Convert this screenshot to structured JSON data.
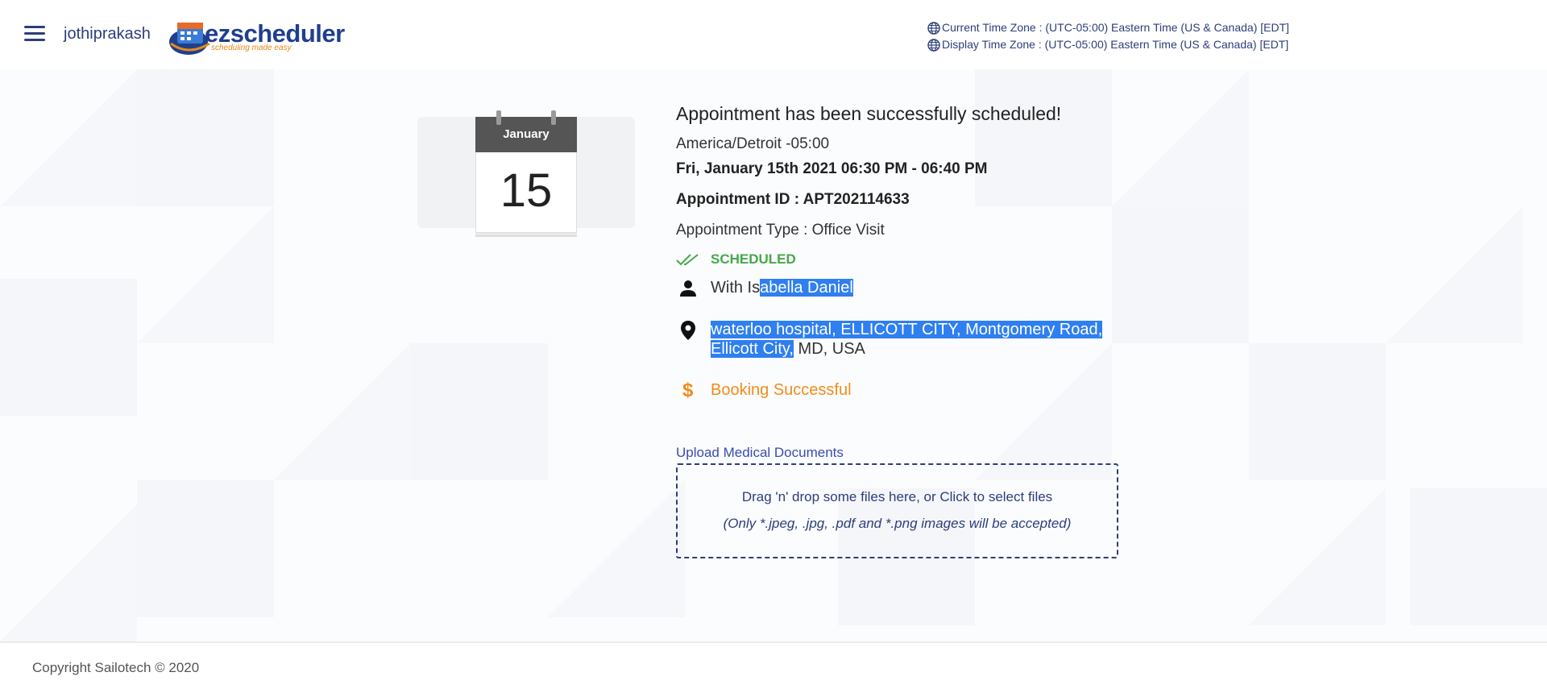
{
  "header": {
    "username": "jothiprakash",
    "logo_word_ez": "ez",
    "logo_word_rest": "scheduler",
    "logo_tagline": "scheduling made easy",
    "current_timezone": "Current Time Zone : (UTC-05:00) Eastern Time (US & Canada) [EDT]",
    "display_timezone": "Display Time Zone : (UTC-05:00) Eastern Time (US & Canada) [EDT]"
  },
  "calendar": {
    "month": "January",
    "day": "15"
  },
  "appointment": {
    "success_message": "Appointment has been successfully scheduled!",
    "timezone": "America/Detroit -05:00",
    "datetime": "Fri, January 15th 2021 06:30 PM - 06:40 PM",
    "id_text": "Appointment ID : APT202114633",
    "type_text": "Appointment Type : Office Visit",
    "status": "SCHEDULED",
    "with_prefix": "With Is",
    "with_highlighted": "abella Daniel ",
    "location_highlighted": "waterloo hospital, ELLICOTT CITY, Montgomery Road, Ellicott City,",
    "location_rest": " MD, USA",
    "payment_status": "Booking Successful"
  },
  "upload": {
    "label": "Upload Medical Documents",
    "instruction": "Drag 'n' drop some files here, or Click to select files",
    "note": "(Only *.jpeg, .jpg, .pdf and *.png images will be accepted)"
  },
  "footer": {
    "copyright": "Copyright Sailotech © 2020"
  },
  "colors": {
    "primary": "#2c3e7a",
    "success": "#46a84a",
    "warning": "#f08c1a",
    "selection": "#2f7ff0"
  },
  "icons": {
    "menu": "hamburger-icon",
    "globe": "globe-icon",
    "status": "double-check-icon",
    "person": "person-icon",
    "location": "location-pin-icon",
    "payment": "dollar-icon"
  }
}
